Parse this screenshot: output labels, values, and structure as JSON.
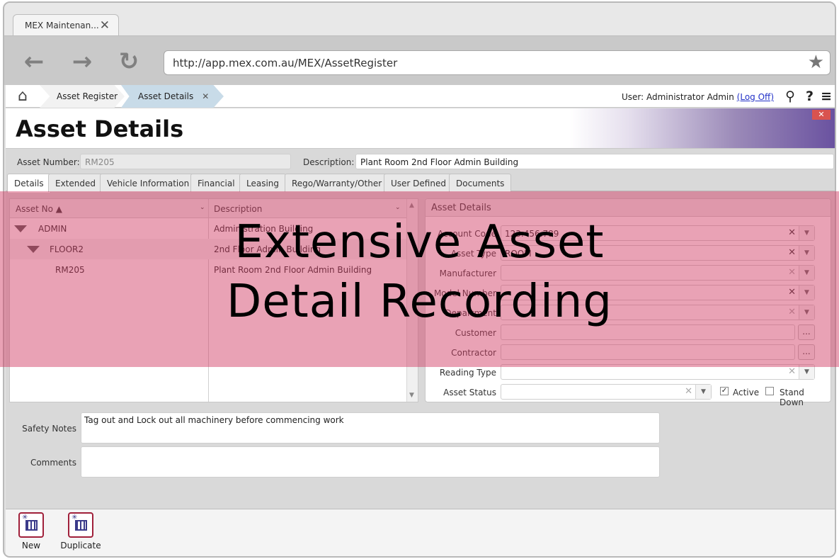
{
  "browser": {
    "tab_title": "MEX Maintenan...",
    "url": "http://app.mex.com.au/MEX/AssetRegister"
  },
  "breadcrumbs": {
    "items": [
      "Asset Register",
      "Asset Details"
    ]
  },
  "header": {
    "user_label": "User: Administrator Admin",
    "logoff_label": "(Log Off)"
  },
  "page": {
    "title": "Asset Details"
  },
  "asset": {
    "number_label": "Asset Number:",
    "number_value": "RM205",
    "description_label": "Description:",
    "description_value": "Plant Room 2nd Floor Admin Building"
  },
  "tabs": [
    "Details",
    "Extended",
    "Vehicle Information",
    "Financial",
    "Leasing",
    "Rego/Warranty/Other",
    "User Defined",
    "Documents"
  ],
  "tree": {
    "col_no": "Asset No ▲",
    "col_desc": "Description",
    "rows": [
      {
        "no": "ADMIN",
        "desc": "Administration Building"
      },
      {
        "no": "FLOOR2",
        "desc": "2nd Floor Admin Building"
      },
      {
        "no": "RM205",
        "desc": "Plant Room 2nd Floor Admin Building"
      }
    ]
  },
  "details_panel": {
    "title": "Asset Details",
    "fields": [
      {
        "label": "Account Code",
        "value": "123.456.789"
      },
      {
        "label": "Asset Type",
        "value": "ROOM"
      },
      {
        "label": "Manufacturer",
        "value": ""
      },
      {
        "label": "Model Number",
        "value": ""
      },
      {
        "label": "Department",
        "value": ""
      },
      {
        "label": "Customer",
        "value": ""
      },
      {
        "label": "Contractor",
        "value": ""
      },
      {
        "label": "Reading Type",
        "value": ""
      },
      {
        "label": "Asset Status",
        "value": ""
      }
    ],
    "ellipsis": "...",
    "active_label": "Active",
    "standdown_label": "Stand Down",
    "active_checked": true
  },
  "notes": {
    "safety_label": "Safety Notes",
    "safety_value": "Tag out and Lock out all machinery before commencing work",
    "comments_label": "Comments",
    "comments_value": ""
  },
  "footer": {
    "new_label": "New",
    "duplicate_label": "Duplicate"
  },
  "overlay": {
    "line1": "Extensive Asset",
    "line2": "Detail Recording"
  },
  "colors": {
    "overlay": "#d23c64",
    "brand_purple": "#6a52a0",
    "button_border": "#a0203a"
  }
}
